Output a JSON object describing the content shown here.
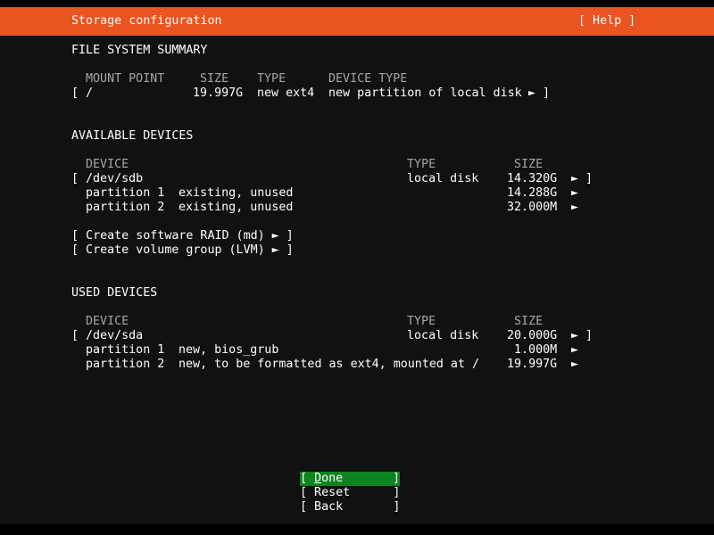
{
  "header": {
    "title": "Storage configuration",
    "help_label": "[ Help ]"
  },
  "fs_summary": {
    "heading": "FILE SYSTEM SUMMARY",
    "columns": [
      "MOUNT POINT",
      "SIZE",
      "TYPE",
      "DEVICE TYPE"
    ],
    "rows": [
      {
        "open": "[",
        "mount": "/",
        "size": "19.997G",
        "type": "new ext4",
        "device_type": "new partition of local disk",
        "arrow": "►",
        "close": "]"
      }
    ]
  },
  "available_devices": {
    "heading": "AVAILABLE DEVICES",
    "columns": [
      "DEVICE",
      "TYPE",
      "SIZE"
    ],
    "disk": {
      "open": "[",
      "name": "/dev/sdb",
      "type": "local disk",
      "size": "14.320G",
      "arrow": "►",
      "close": "]"
    },
    "partitions": [
      {
        "name": "partition 1",
        "desc": "existing, unused",
        "size": "14.288G",
        "arrow": "►"
      },
      {
        "name": "partition 2",
        "desc": "existing, unused",
        "size": "32.000M",
        "arrow": "►"
      }
    ],
    "actions": [
      {
        "label": "[ Create software RAID (md) ► ]"
      },
      {
        "label": "[ Create volume group (LVM) ► ]"
      }
    ]
  },
  "used_devices": {
    "heading": "USED DEVICES",
    "columns": [
      "DEVICE",
      "TYPE",
      "SIZE"
    ],
    "disk": {
      "open": "[",
      "name": "/dev/sda",
      "type": "local disk",
      "size": "20.000G",
      "arrow": "►",
      "close": "]"
    },
    "partitions": [
      {
        "name": "partition 1",
        "desc": "new, bios_grub",
        "size": "1.000M",
        "arrow": "►"
      },
      {
        "name": "partition 2",
        "desc": "new, to be formatted as ext4, mounted at /",
        "size": "19.997G",
        "arrow": "►"
      }
    ]
  },
  "buttons": {
    "done": {
      "open": "[ ",
      "hotkey": "D",
      "rest": "one",
      "close": "]"
    },
    "reset": {
      "label": "[ Reset      ]"
    },
    "back": {
      "label": "[ Back       ]"
    }
  },
  "colors": {
    "header_bg": "#e95420",
    "focus_bg": "#0e8420",
    "main_bg": "#111111"
  }
}
